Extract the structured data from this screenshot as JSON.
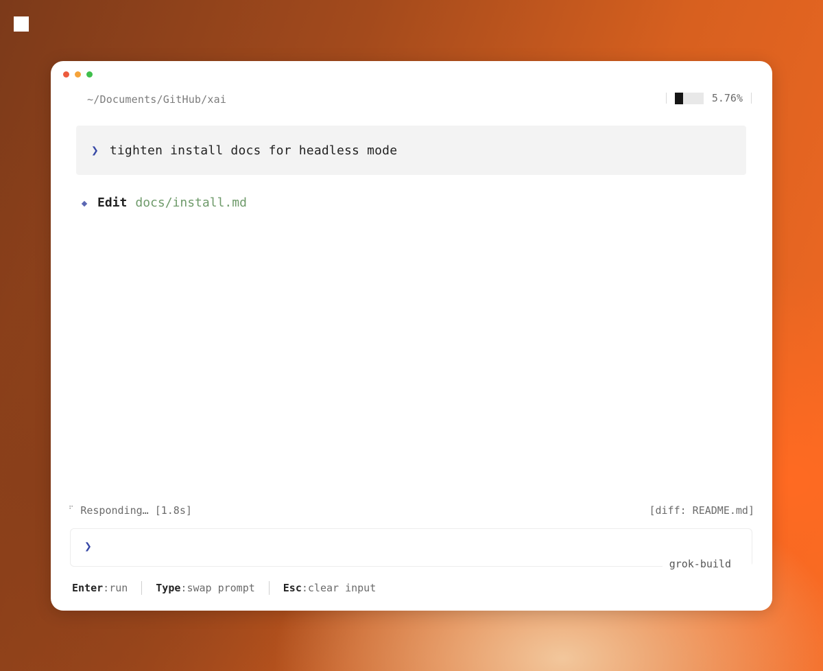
{
  "window": {
    "path": "~/Documents/GitHub/xai",
    "usage": {
      "percent_label": "5.76%",
      "fill_fraction": 0.3
    }
  },
  "conversation": {
    "prompt": "tighten install docs for headless mode",
    "edit": {
      "label": "Edit",
      "file": "docs/install.md"
    }
  },
  "status": {
    "text": "Responding… [1.8s]",
    "diff": "[diff: README.md]"
  },
  "input": {
    "placeholder": "",
    "model": "grok-build"
  },
  "shortcuts": [
    {
      "key": "Enter",
      "action": "run"
    },
    {
      "key": "Type",
      "action": "swap prompt"
    },
    {
      "key": "Esc",
      "action": "clear input"
    }
  ],
  "colors": {
    "accent": "#3748a6",
    "file_green": "#6e9a6a"
  }
}
